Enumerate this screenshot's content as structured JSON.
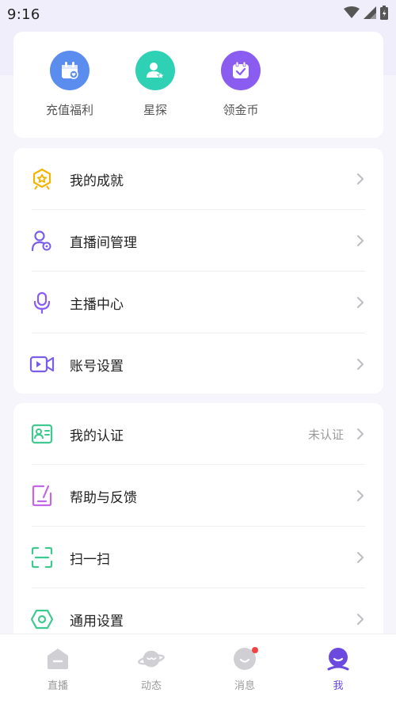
{
  "status_bar": {
    "time": "9:16"
  },
  "quick_actions": [
    {
      "label": "充值福利",
      "icon": "gift-calendar-icon",
      "color": "#5b8def"
    },
    {
      "label": "星探",
      "icon": "user-star-icon",
      "color": "#2fd1b5"
    },
    {
      "label": "领金币",
      "icon": "calendar-check-icon",
      "color": "#8a5cf0"
    }
  ],
  "menu_group_1": [
    {
      "label": "我的成就",
      "icon": "achievement-icon",
      "color": "#f2b400"
    },
    {
      "label": "直播间管理",
      "icon": "user-gear-icon",
      "color": "#7a5ee8"
    },
    {
      "label": "主播中心",
      "icon": "microphone-icon",
      "color": "#8a5cf0"
    },
    {
      "label": "账号设置",
      "icon": "video-camera-icon",
      "color": "#7a5ee8"
    }
  ],
  "menu_group_2": [
    {
      "label": "我的认证",
      "icon": "id-card-icon",
      "color": "#3ec98e",
      "status": "未认证"
    },
    {
      "label": "帮助与反馈",
      "icon": "feedback-icon",
      "color": "#c366e8"
    },
    {
      "label": "扫一扫",
      "icon": "scan-icon",
      "color": "#3ec98e"
    },
    {
      "label": "通用设置",
      "icon": "settings-hex-icon",
      "color": "#3ec98e"
    }
  ],
  "tabbar": {
    "items": [
      {
        "label": "直播",
        "icon": "live-icon",
        "active": false
      },
      {
        "label": "动态",
        "icon": "planet-icon",
        "active": false
      },
      {
        "label": "消息",
        "icon": "message-icon",
        "active": false,
        "badge": true
      },
      {
        "label": "我",
        "icon": "me-icon",
        "active": true
      }
    ],
    "active_color": "#6c4ae0",
    "inactive_color": "#cfcfd4"
  }
}
